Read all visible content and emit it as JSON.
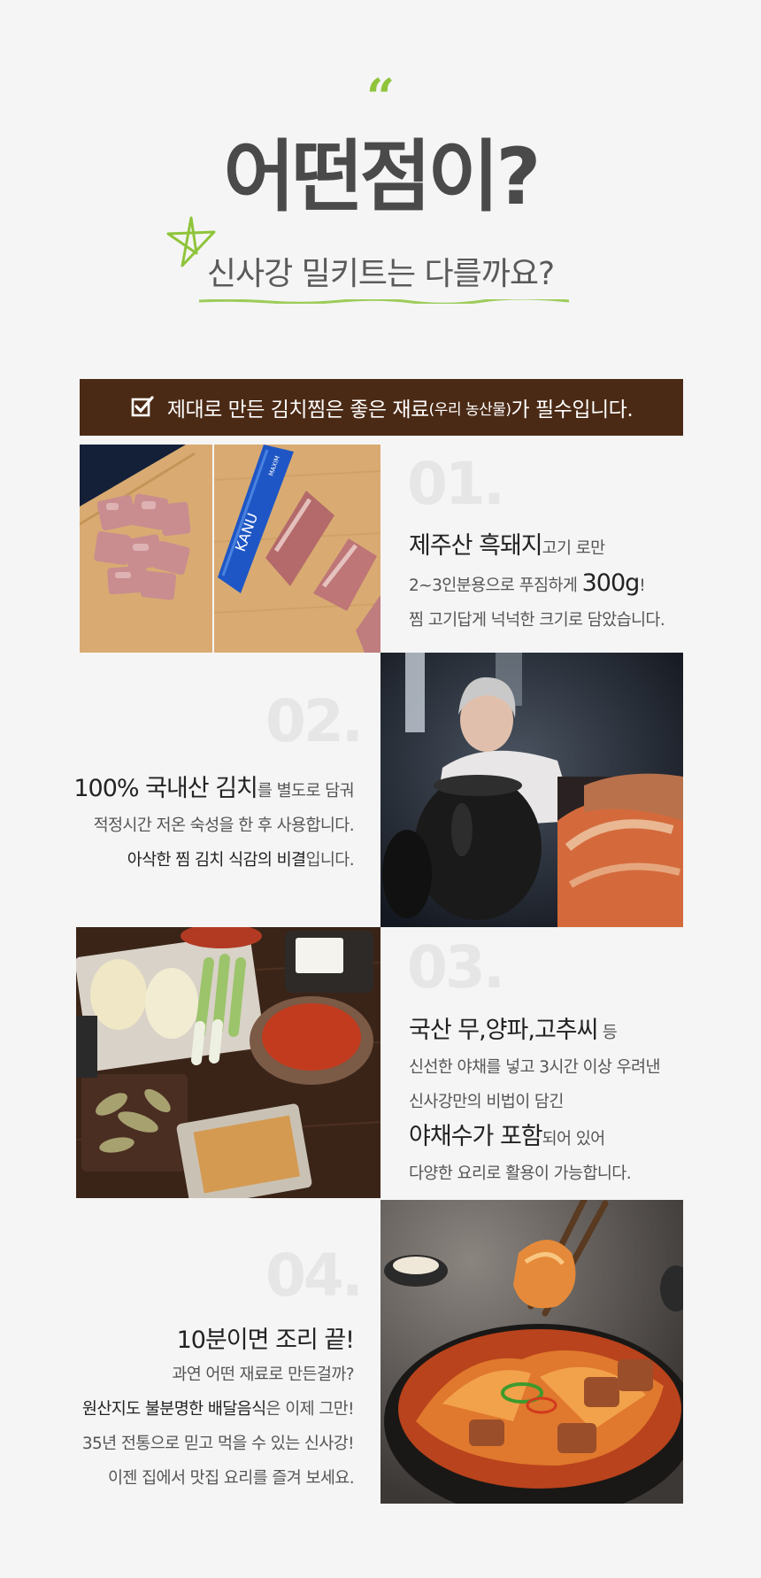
{
  "header": {
    "quote_mark": "“",
    "title": "어떤점이?",
    "subtitle": "신사강 밀키트는 다를까요?"
  },
  "banner": {
    "text_main": "제대로 만든 김치찜은 좋은 재료",
    "text_small": "(우리 농산물)",
    "text_end": "가 필수입니다."
  },
  "sections": [
    {
      "number": "01.",
      "line1_strong": "제주산 흑돼지",
      "line1_rest": "고기 로만",
      "line2_pre": "2~3인분용으로 푸짐하게 ",
      "line2_big": "300g",
      "line2_post": "!",
      "line3": "찜 고기답게 넉넉한 크기로 담았습니다."
    },
    {
      "number": "02.",
      "line1_strong": "100% 국내산 김치",
      "line1_rest": "를  별도로 담궈",
      "line2": "적정시간 저온 숙성을 한 후 사용합니다.",
      "line3_strong": "아삭한 찜 김치 식감의 비결",
      "line3_rest": "입니다."
    },
    {
      "number": "03.",
      "line1_strong": "국산 무,양파,고추씨",
      "line1_rest": " 등",
      "line2": "신선한 야채를 넣고 3시간 이상 우려낸",
      "line3": "신사강만의 비법이 담긴",
      "line4_strong": "야채수가 포함",
      "line4_rest": "되어 있어",
      "line5": "다양한 요리로 활용이 가능합니다."
    },
    {
      "number": "04.",
      "line1": "10분이면 조리 끝!",
      "line2": "과연 어떤 재료로 만든걸까?",
      "line3_strong": "원산지도 불분명한 배달음식",
      "line3_rest": "은 이제 그만!",
      "line4": "35년 전통으로 믿고 먹을 수 있는 신사강!",
      "line5": "이젠 집에서 맛집 요리를 즐겨 보세요."
    }
  ],
  "images": {
    "pork_label": "KANU",
    "pork_label_small": "MAXIM"
  },
  "colors": {
    "accent_green": "#8fc43b",
    "banner_brown": "#4b2a15",
    "number_gray": "#e6e6e6"
  }
}
